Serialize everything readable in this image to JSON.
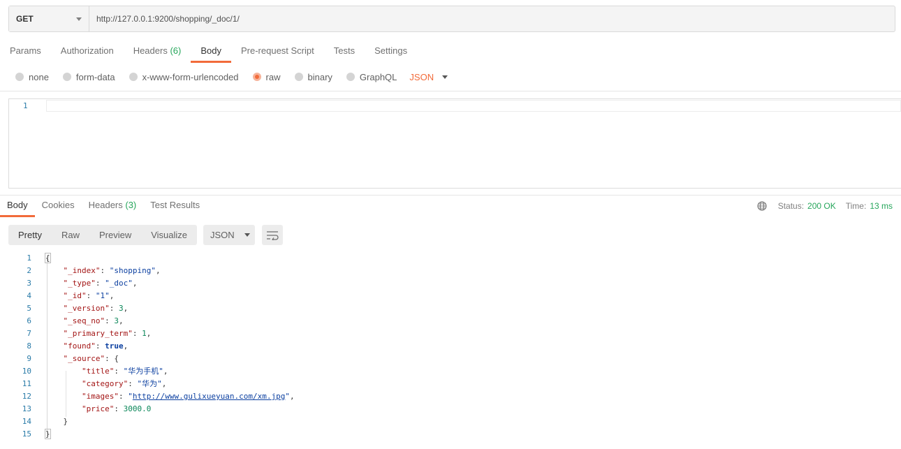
{
  "request": {
    "method": "GET",
    "url": "http://127.0.0.1:9200/shopping/_doc/1/"
  },
  "request_tabs": [
    {
      "label": "Params"
    },
    {
      "label": "Authorization"
    },
    {
      "label": "Headers",
      "count": "(6)"
    },
    {
      "label": "Body",
      "active": true
    },
    {
      "label": "Pre-request Script"
    },
    {
      "label": "Tests"
    },
    {
      "label": "Settings"
    }
  ],
  "body_types": {
    "none": "none",
    "form_data": "form-data",
    "urlencoded": "x-www-form-urlencoded",
    "raw": "raw",
    "binary": "binary",
    "graphql": "GraphQL",
    "selected": "raw",
    "format": "JSON"
  },
  "request_editor": {
    "line_numbers": [
      "1"
    ]
  },
  "response_tabs": [
    {
      "label": "Body",
      "active": true
    },
    {
      "label": "Cookies"
    },
    {
      "label": "Headers",
      "count": "(3)"
    },
    {
      "label": "Test Results"
    }
  ],
  "response_status": {
    "status_label": "Status:",
    "status_value": "200 OK",
    "time_label": "Time:",
    "time_value": "13 ms"
  },
  "response_views": [
    "Pretty",
    "Raw",
    "Preview",
    "Visualize"
  ],
  "response_format": "JSON",
  "response_code": {
    "line_numbers": [
      "1",
      "2",
      "3",
      "4",
      "5",
      "6",
      "7",
      "8",
      "9",
      "10",
      "11",
      "12",
      "13",
      "14",
      "15"
    ],
    "open_brace": "{",
    "close_brace": "}",
    "index_key": "\"_index\"",
    "index_val": "\"shopping\"",
    "type_key": "\"_type\"",
    "type_val": "\"_doc\"",
    "id_key": "\"_id\"",
    "id_val": "\"1\"",
    "version_key": "\"_version\"",
    "version_val": "3",
    "seq_key": "\"_seq_no\"",
    "seq_val": "3",
    "term_key": "\"_primary_term\"",
    "term_val": "1",
    "found_key": "\"found\"",
    "found_val": "true",
    "source_key": "\"_source\"",
    "title_key": "\"title\"",
    "title_val": "\"华为手机\"",
    "category_key": "\"category\"",
    "category_val": "\"华为\"",
    "images_key": "\"images\"",
    "images_val": "http://www.gulixueyuan.com/xm.jpg",
    "price_key": "\"price\"",
    "price_val": "3000.0"
  }
}
